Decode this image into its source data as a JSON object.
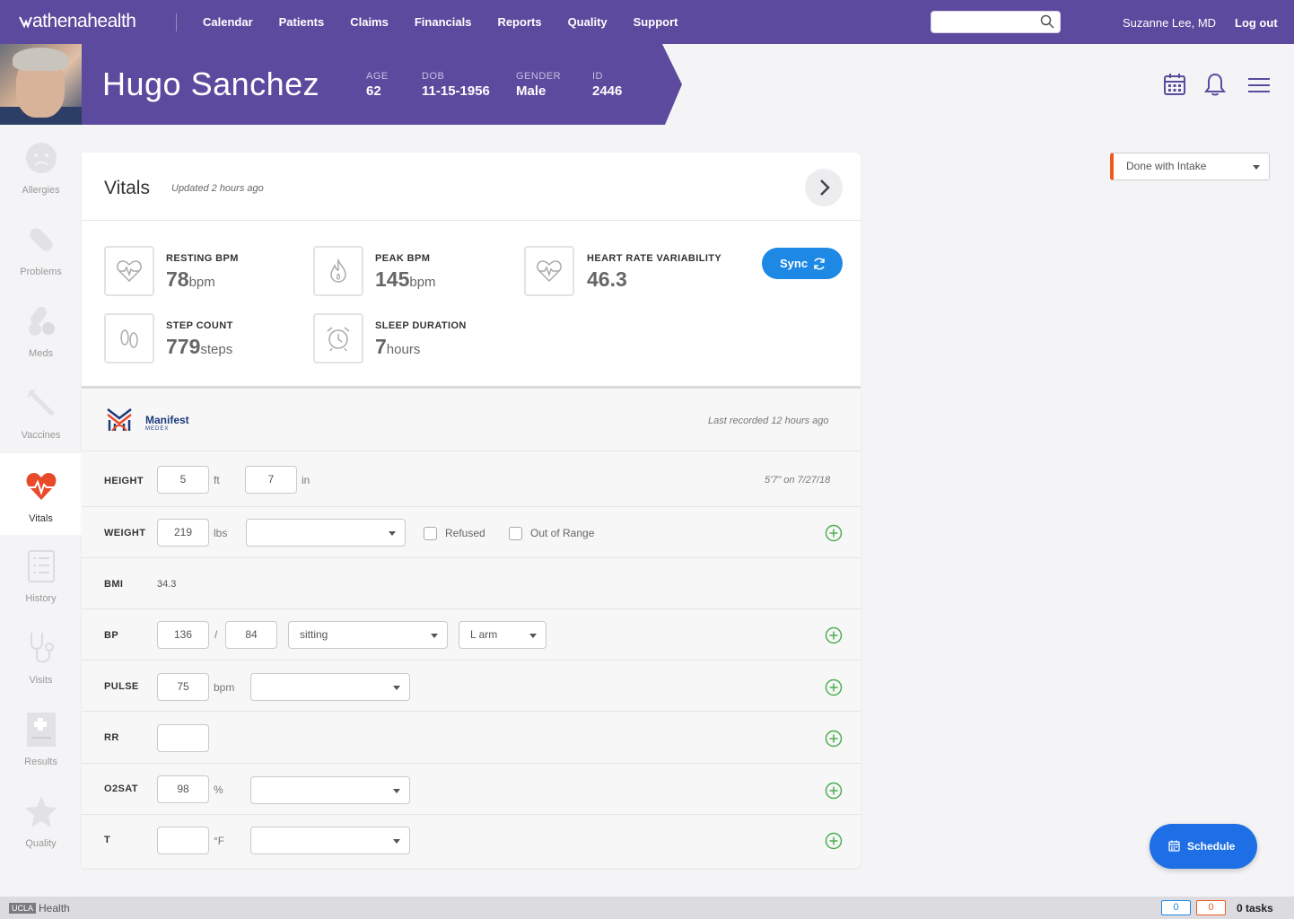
{
  "nav": {
    "logo_bold": "athena",
    "logo_light": "health",
    "links": [
      "Calendar",
      "Patients",
      "Claims",
      "Financials",
      "Reports",
      "Quality",
      "Support"
    ],
    "search_placeholder": "",
    "user": "Suzanne Lee, MD",
    "logout": "Log out"
  },
  "patient": {
    "name": "Hugo Sanchez",
    "fields": [
      {
        "label": "AGE",
        "value": "62"
      },
      {
        "label": "DOB",
        "value": "11-15-1956"
      },
      {
        "label": "GENDER",
        "value": "Male"
      },
      {
        "label": "ID",
        "value": "2446"
      }
    ]
  },
  "sidebar": {
    "items": [
      {
        "label": "Allergies",
        "icon": "allergies-icon"
      },
      {
        "label": "Problems",
        "icon": "bandage-icon"
      },
      {
        "label": "Meds",
        "icon": "pills-icon"
      },
      {
        "label": "Vaccines",
        "icon": "syringe-icon"
      },
      {
        "label": "Vitals",
        "icon": "heart-pulse-icon",
        "active": true
      },
      {
        "label": "History",
        "icon": "clipboard-icon"
      },
      {
        "label": "Visits",
        "icon": "stethoscope-icon"
      },
      {
        "label": "Results",
        "icon": "medical-file-icon"
      },
      {
        "label": "Quality",
        "icon": "star-icon"
      }
    ]
  },
  "vitals": {
    "title": "Vitals",
    "updated": "Updated 2 hours ago",
    "sync_label": "Sync",
    "metrics": {
      "resting": {
        "label": "RESTING BPM",
        "value": "78",
        "unit": "bpm"
      },
      "peak": {
        "label": "PEAK BPM",
        "value": "145",
        "unit": "bpm"
      },
      "hrv": {
        "label": "HEART RATE VARIABILITY",
        "value": "46.3",
        "unit": ""
      },
      "steps": {
        "label": "STEP COUNT",
        "value": "779",
        "unit": "steps"
      },
      "sleep": {
        "label": "SLEEP DURATION",
        "value": "7",
        "unit": "hours"
      }
    }
  },
  "manifest": {
    "name": "Manifest",
    "sub": "MEDEX",
    "last_recorded": "Last recorded 12 hours ago"
  },
  "form": {
    "height": {
      "label": "HEIGHT",
      "ft": "5",
      "ft_unit": "ft",
      "in": "7",
      "in_unit": "in",
      "history": "5'7\" on 7/27/18"
    },
    "weight": {
      "label": "WEIGHT",
      "value": "219",
      "unit": "lbs",
      "select": "",
      "refused": "Refused",
      "out_of_range": "Out of Range"
    },
    "bmi": {
      "label": "BMI",
      "value": "34.3"
    },
    "bp": {
      "label": "BP",
      "systolic": "136",
      "sep": "/",
      "diastolic": "84",
      "position": "sitting",
      "site": "L arm"
    },
    "pulse": {
      "label": "PULSE",
      "value": "75",
      "unit": "bpm",
      "select": ""
    },
    "rr": {
      "label": "RR",
      "value": ""
    },
    "o2sat": {
      "label": "O2SAT",
      "value": "98",
      "unit": "%",
      "select": ""
    },
    "t": {
      "label": "T",
      "value": "",
      "unit": "°F",
      "select": ""
    }
  },
  "status_select": "Done with Intake",
  "schedule_label": "Schedule",
  "footer": {
    "org_box": "UCLA",
    "org": "Health",
    "count_blue": "0",
    "count_red": "0",
    "tasks": "0 tasks"
  },
  "colors": {
    "brand": "#5b4a9e",
    "accent_blue": "#1e88e5",
    "status_orange": "#f05a22",
    "vitals_red": "#e84a2a",
    "plus_green": "#4caf50"
  }
}
